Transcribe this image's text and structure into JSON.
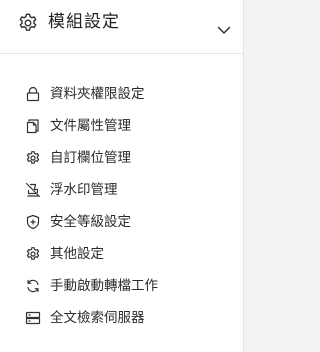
{
  "header": {
    "title": "模組設定",
    "icon": "gear-icon",
    "toggle_icon": "chevron-down-icon"
  },
  "menu": {
    "items": [
      {
        "label": "資料夾權限設定",
        "icon": "lock-icon"
      },
      {
        "label": "文件屬性管理",
        "icon": "copy-icon"
      },
      {
        "label": "自訂欄位管理",
        "icon": "gear-icon"
      },
      {
        "label": "浮水印管理",
        "icon": "stamp-off-icon"
      },
      {
        "label": "安全等級設定",
        "icon": "shield-icon"
      },
      {
        "label": "其他設定",
        "icon": "gear-icon"
      },
      {
        "label": "手動啟動轉檔工作",
        "icon": "refresh-icon"
      },
      {
        "label": "全文檢索伺服器",
        "icon": "server-icon"
      }
    ]
  }
}
